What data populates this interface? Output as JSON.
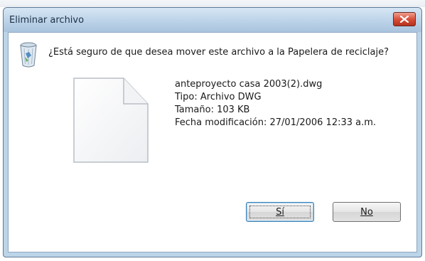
{
  "dialog": {
    "title": "Eliminar archivo",
    "close_icon": "close-icon",
    "question": "¿Está seguro de que desea mover este archivo a la Papelera de reciclaje?",
    "recycle_icon": "recycle-bin-icon",
    "file_icon": "document-icon",
    "file": {
      "name": "anteproyecto casa 2003(2).dwg",
      "type": "Tipo: Archivo DWG",
      "size": "Tamaño: 103 KB",
      "modified": "Fecha modificación: 27/01/2006 12:33 a.m."
    },
    "buttons": {
      "yes_label": "Sí",
      "no_label": "No"
    }
  },
  "colors": {
    "titlebar": "#bcd3e8",
    "close": "#d8503a",
    "focus_border": "#3c7fb1"
  }
}
